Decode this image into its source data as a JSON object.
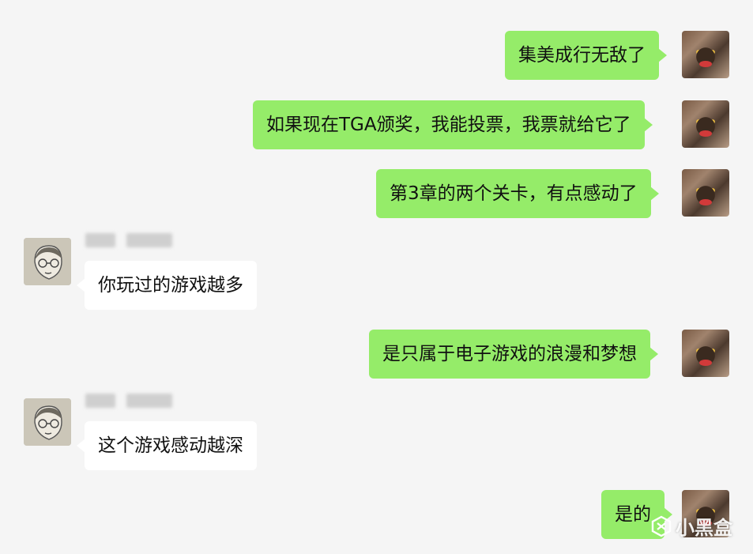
{
  "messages": [
    {
      "side": "right",
      "text": "集美成行无敌了"
    },
    {
      "side": "right",
      "text": "如果现在TGA颁奖，我能投票，我票就给它了"
    },
    {
      "side": "right",
      "text": "第3章的两个关卡，有点感动了"
    },
    {
      "side": "left",
      "text": "你玩过的游戏越多"
    },
    {
      "side": "right",
      "text": "是只属于电子游戏的浪漫和梦想"
    },
    {
      "side": "left",
      "text": "这个游戏感动越深"
    },
    {
      "side": "right",
      "text": "是的"
    }
  ],
  "watermark": {
    "text": "小黑盒",
    "icon": "xiaoheihe-logo-icon"
  },
  "colors": {
    "background": "#f5f5f5",
    "self_bubble": "#95ec69",
    "other_bubble": "#ffffff"
  }
}
